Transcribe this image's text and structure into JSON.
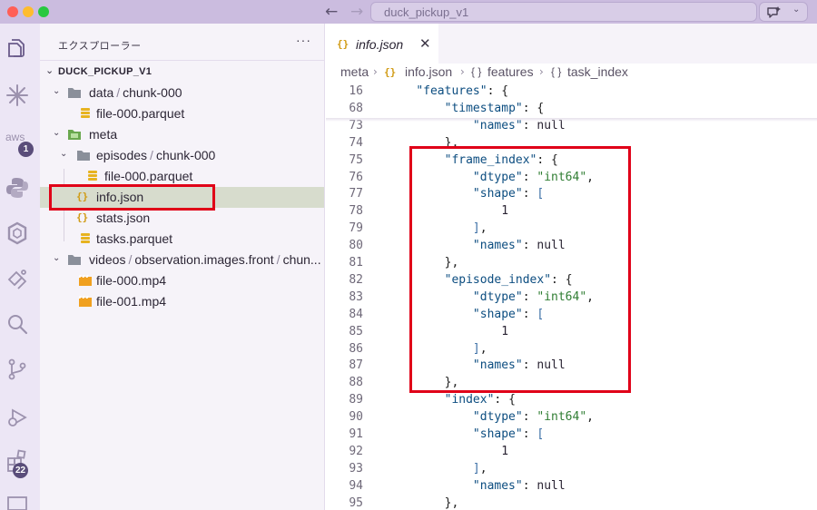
{
  "window": {
    "command_center_text": "duck_pickup_v1",
    "nav_back": "←",
    "nav_forward": "→",
    "chevron": "⌄"
  },
  "activity_bar": {
    "items": [
      {
        "name": "explorer-icon"
      },
      {
        "name": "spark-icon"
      },
      {
        "name": "aws-icon",
        "label": "aws",
        "badge": "1"
      },
      {
        "name": "python-icon"
      },
      {
        "name": "openai-icon"
      },
      {
        "name": "paw-icon"
      },
      {
        "name": "search-icon"
      },
      {
        "name": "source-control-icon"
      },
      {
        "name": "run-debug-icon"
      },
      {
        "name": "extensions-icon",
        "badge": "22"
      },
      {
        "name": "remote-explorer-icon"
      }
    ]
  },
  "sidebar": {
    "title": "エクスプローラー",
    "more": "···",
    "root": "DUCK_PICKUP_V1",
    "tree": [
      {
        "depth": 1,
        "type": "folder",
        "parts": [
          "data",
          "chunk-000"
        ]
      },
      {
        "depth": 2,
        "type": "db",
        "label": "file-000.parquet"
      },
      {
        "depth": 1,
        "type": "folder-meta",
        "parts": [
          "meta"
        ]
      },
      {
        "depth": 2,
        "type": "folder",
        "parts": [
          "episodes",
          "chunk-000"
        ]
      },
      {
        "depth": 3,
        "type": "db",
        "label": "file-000.parquet"
      },
      {
        "depth": 2,
        "type": "json",
        "label": "info.json",
        "selected": true
      },
      {
        "depth": 2,
        "type": "json",
        "label": "stats.json"
      },
      {
        "depth": 2,
        "type": "db",
        "label": "tasks.parquet"
      },
      {
        "depth": 1,
        "type": "folder",
        "parts": [
          "videos",
          "observation.images.front",
          "chun..."
        ]
      },
      {
        "depth": 2,
        "type": "video",
        "label": "file-000.mp4"
      },
      {
        "depth": 2,
        "type": "video",
        "label": "file-001.mp4"
      }
    ]
  },
  "editor": {
    "tab": {
      "label": "info.json",
      "close": "✕",
      "brace": "{}"
    },
    "breadcrumb": [
      "meta",
      "info.json",
      "features",
      "task_index"
    ],
    "breadcrumb_sep": "›",
    "lines": [
      {
        "n": "16",
        "text": "    \"features\": {",
        "sticky": true
      },
      {
        "n": "68",
        "text": "        \"timestamp\": {",
        "sticky": true
      },
      {
        "n": "73",
        "text": "            \"names\": null"
      },
      {
        "n": "74",
        "text": "        },"
      },
      {
        "n": "75",
        "text": "        \"frame_index\": {"
      },
      {
        "n": "76",
        "text": "            \"dtype\": \"int64\","
      },
      {
        "n": "77",
        "text": "            \"shape\": ["
      },
      {
        "n": "78",
        "text": "                1"
      },
      {
        "n": "79",
        "text": "            ],"
      },
      {
        "n": "80",
        "text": "            \"names\": null"
      },
      {
        "n": "81",
        "text": "        },"
      },
      {
        "n": "82",
        "text": "        \"episode_index\": {"
      },
      {
        "n": "83",
        "text": "            \"dtype\": \"int64\","
      },
      {
        "n": "84",
        "text": "            \"shape\": ["
      },
      {
        "n": "85",
        "text": "                1"
      },
      {
        "n": "86",
        "text": "            ],"
      },
      {
        "n": "87",
        "text": "            \"names\": null"
      },
      {
        "n": "88",
        "text": "        },"
      },
      {
        "n": "89",
        "text": "        \"index\": {"
      },
      {
        "n": "90",
        "text": "            \"dtype\": \"int64\","
      },
      {
        "n": "91",
        "text": "            \"shape\": ["
      },
      {
        "n": "92",
        "text": "                1"
      },
      {
        "n": "93",
        "text": "            ],"
      },
      {
        "n": "94",
        "text": "            \"names\": null"
      },
      {
        "n": "95",
        "text": "        },"
      }
    ]
  },
  "colors": {
    "highlight": "#e00018",
    "title_bar": "#cbbcdf",
    "selection": "#d7dccd"
  }
}
